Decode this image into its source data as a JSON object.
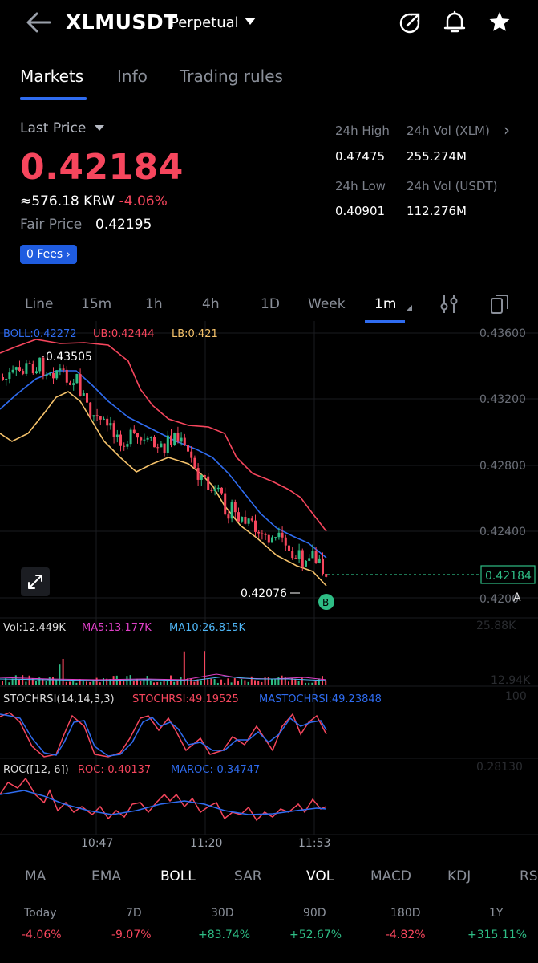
{
  "header": {
    "title": "XLMUSDT",
    "subtitle": "Perpetual"
  },
  "tabs": [
    {
      "label": "Markets"
    },
    {
      "label": "Info"
    },
    {
      "label": "Trading rules"
    }
  ],
  "price": {
    "label": "Last Price",
    "value": "0.42184",
    "krw": "≈576.18 KRW",
    "change": "-4.06%",
    "fair_label": "Fair Price",
    "fair_value": "0.42195",
    "fees_label": "0 Fees"
  },
  "stats": {
    "high_label": "24h High",
    "high_value": "0.47475",
    "vol_xlm_label": "24h Vol (XLM)",
    "vol_xlm_value": "255.274M",
    "low_label": "24h Low",
    "low_value": "0.40901",
    "vol_usdt_label": "24h Vol  (USDT)",
    "vol_usdt_value": "112.276M"
  },
  "intervals": [
    "Line",
    "15m",
    "1h",
    "4h",
    "1D",
    "Week",
    "1m"
  ],
  "chart": {
    "boll_label": "BOLL:0.42272",
    "ub_label": "UB:0.42444",
    "lb_label": "LB:0.421",
    "y_ticks": [
      "0.43600",
      "0.43200",
      "0.42800",
      "0.42400",
      "0.4200"
    ],
    "high_marker": "0.43505",
    "low_marker": "0.42076",
    "current_price": "0.42184",
    "buy_marker": "B",
    "vol_label": "Vol:12.449K",
    "ma5_label": "MA5:13.177K",
    "ma10_label": "MA10:26.815K",
    "vol_axis_1": "25.88K",
    "vol_axis_2": "12.94K",
    "stoch_label": "STOCHRSI(14,14,3,3)",
    "stoch_val": "STOCHRSI:49.19525",
    "mastoch_val": "MASTOCHRSI:49.23848",
    "stoch_axis": "100",
    "roc_label": "ROC([12, 6])",
    "roc_val": "ROC:-0.40137",
    "maroc_val": "MAROC:-0.34747",
    "roc_axis": "0.28130",
    "times": [
      "10:47",
      "11:20",
      "11:53"
    ],
    "colors": {
      "boll": "#2f6cf0",
      "ub": "#f6465d",
      "lb": "#f5c26b",
      "up": "#2ebd85",
      "down": "#f6465d"
    }
  },
  "indicators": [
    "MA",
    "EMA",
    "BOLL",
    "SAR",
    "VOL",
    "MACD",
    "KDJ",
    "RS"
  ],
  "performance": [
    {
      "label": "Today",
      "value": "-4.06%",
      "sign": "neg"
    },
    {
      "label": "7D",
      "value": "-9.07%",
      "sign": "neg"
    },
    {
      "label": "30D",
      "value": "+83.74%",
      "sign": "pos"
    },
    {
      "label": "90D",
      "value": "+52.67%",
      "sign": "pos"
    },
    {
      "label": "180D",
      "value": "-4.82%",
      "sign": "neg"
    },
    {
      "label": "1Y",
      "value": "+315.11%",
      "sign": "pos"
    }
  ]
}
